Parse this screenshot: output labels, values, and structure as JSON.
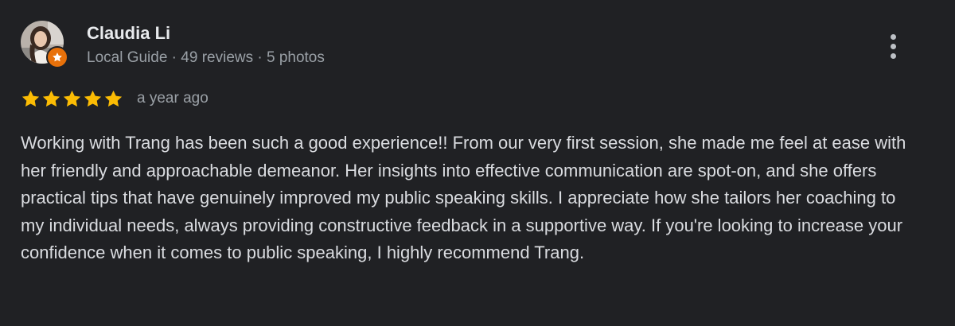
{
  "review": {
    "author": {
      "name": "Claudia Li",
      "meta": "Local Guide · 49 reviews · 5 photos",
      "avatar_icon": "profile-photo",
      "badge_icon": "local-guide-star-badge",
      "badge_color": "#e8710a"
    },
    "rating": {
      "stars": 5,
      "max_stars": 5,
      "star_color": "#fbbc04"
    },
    "timestamp": "a year ago",
    "menu_icon": "more-vert-icon",
    "text": "Working with Trang has been such a good experience!! From our very first session, she made me feel at ease with her friendly and approachable demeanor. Her insights into effective communication are spot-on, and she offers practical tips that have genuinely improved my public speaking skills. I appreciate how she tailors her coaching to my individual needs, always providing constructive feedback in a supportive way. If you're looking to increase your confidence when it comes to public speaking, I highly recommend Trang."
  }
}
